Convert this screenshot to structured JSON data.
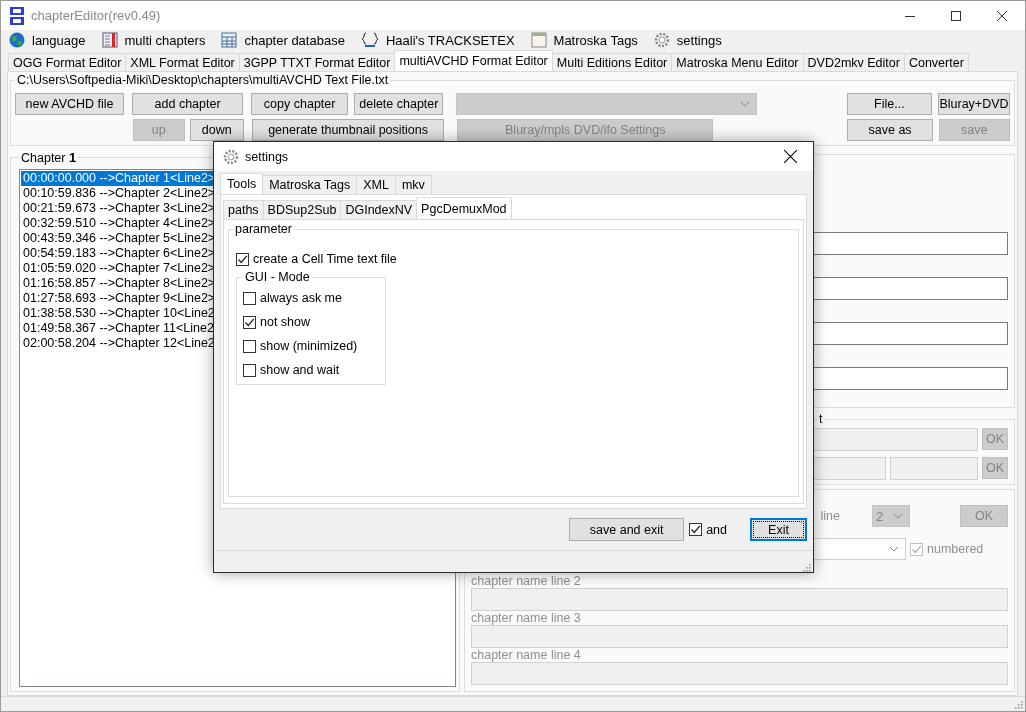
{
  "window": {
    "title": "chapterEditor(rev0.49)"
  },
  "menu": [
    {
      "label": "language"
    },
    {
      "label": "multi chapters"
    },
    {
      "label": "chapter database"
    },
    {
      "label": "Haali's TRACKSETEX"
    },
    {
      "label": "Matroska Tags"
    },
    {
      "label": "settings"
    }
  ],
  "tabs": [
    {
      "label": "OGG Format Editor",
      "selected": false
    },
    {
      "label": "XML Format Editor",
      "selected": false
    },
    {
      "label": "3GPP TTXT Format Editor",
      "selected": false
    },
    {
      "label": "multiAVCHD Format Editor",
      "selected": true
    },
    {
      "label": "Multi Editions Editor",
      "selected": false
    },
    {
      "label": "Matroska Menu Editor",
      "selected": false
    },
    {
      "label": "DVD2mkv Editor",
      "selected": false
    },
    {
      "label": "Converter",
      "selected": false
    }
  ],
  "file_path": "C:\\Users\\Softpedia-Miki\\Desktop\\chapters\\multiAVCHD Text File.txt",
  "row_1": [
    {
      "kind": "button",
      "label": "new AVCHD file",
      "disabled": false
    },
    {
      "kind": "button",
      "label": "add chapter",
      "disabled": false
    },
    {
      "kind": "button",
      "label": "copy chapter",
      "disabled": false
    },
    {
      "kind": "button",
      "label": "delete chapter",
      "disabled": false
    },
    {
      "kind": "dropdown",
      "disabled": true
    },
    {
      "kind": "button",
      "label": "File...",
      "disabled": false
    },
    {
      "kind": "button",
      "label": "Bluray+DVD",
      "disabled": false
    }
  ],
  "row_2": [
    {
      "kind": "button",
      "label": "up",
      "disabled": true
    },
    {
      "kind": "button",
      "label": "down",
      "disabled": false
    },
    {
      "kind": "button",
      "label": "generate thumbnail positions",
      "disabled": false
    },
    {
      "kind": "button",
      "label": "Bluray/mpls DVD/ifo Settings",
      "disabled": true
    },
    {
      "kind": "button",
      "label": "save as",
      "disabled": false
    },
    {
      "kind": "button",
      "label": "save",
      "disabled": true
    }
  ],
  "chapter_group": {
    "label": "Chapter",
    "number": "1"
  },
  "chapters": [
    {
      "text": "00:00:00.000 -->Chapter 1<Line2>",
      "selected": true
    },
    {
      "text": "00:10:59.836 -->Chapter 2<Line2>",
      "selected": false
    },
    {
      "text": "00:21:59.673 -->Chapter 3<Line2>",
      "selected": false
    },
    {
      "text": "00:32:59.510 -->Chapter 4<Line2>",
      "selected": false
    },
    {
      "text": "00:43:59.346 -->Chapter 5<Line2>",
      "selected": false
    },
    {
      "text": "00:54:59.183 -->Chapter 6<Line2>",
      "selected": false
    },
    {
      "text": "01:05:59.020 -->Chapter 7<Line2>",
      "selected": false
    },
    {
      "text": "01:16:58.857 -->Chapter 8<Line2>",
      "selected": false
    },
    {
      "text": "01:27:58.693 -->Chapter 9<Line2>",
      "selected": false
    },
    {
      "text": "01:38:58.530 -->Chapter 10<Line2",
      "selected": false
    },
    {
      "text": "01:49:58.367 -->Chapter 11<Line2",
      "selected": false
    },
    {
      "text": "02:00:58.204 -->Chapter 12<Line2",
      "selected": false
    }
  ],
  "edit_group": {
    "label": "t",
    "ok_1": "OK",
    "ok_2": "OK"
  },
  "line_label": "line",
  "line_count": "2",
  "line_ok": "OK",
  "numbered": {
    "label": "numbered",
    "checked": true,
    "disabled": true
  },
  "name_lines": [
    {
      "label": "chapter name line 2"
    },
    {
      "label": "chapter name line 3"
    },
    {
      "label": "chapter name line 4"
    }
  ],
  "settings_dialog": {
    "title": "settings",
    "tabs": [
      {
        "label": "Tools",
        "selected": true
      },
      {
        "label": "Matroska Tags",
        "selected": false
      },
      {
        "label": "XML",
        "selected": false
      },
      {
        "label": "mkv",
        "selected": false
      }
    ],
    "subtabs": [
      {
        "label": "paths",
        "selected": false
      },
      {
        "label": "BDSup2Sub",
        "selected": false
      },
      {
        "label": "DGIndexNV",
        "selected": false
      },
      {
        "label": "PgcDemuxMod",
        "selected": true
      }
    ],
    "group": "parameter",
    "cell_time": {
      "label": "create a Cell Time text file",
      "checked": true
    },
    "gui_mode": {
      "label": "GUI - Mode",
      "options": [
        {
          "label": "always ask me",
          "checked": false
        },
        {
          "label": "not show",
          "checked": true
        },
        {
          "label": "show (minimized)",
          "checked": false
        },
        {
          "label": "show and wait",
          "checked": false
        }
      ]
    },
    "save_and_exit": "save and exit",
    "and": {
      "label": "and",
      "checked": true
    },
    "exit": "Exit"
  }
}
